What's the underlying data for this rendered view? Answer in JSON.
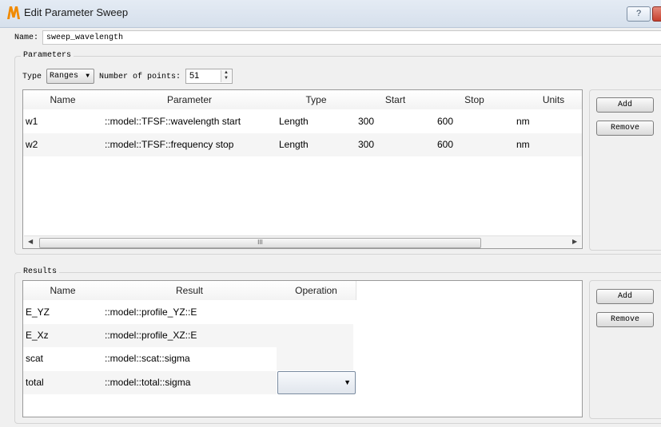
{
  "window": {
    "title": "Edit Parameter Sweep",
    "help_label": "?"
  },
  "name_row": {
    "label": "Name:",
    "value": "sweep_wavelength"
  },
  "parameters": {
    "group_label": "Parameters",
    "type_label": "Type",
    "type_value": "Ranges",
    "points_label": "Number of points:",
    "points_value": "51",
    "columns": [
      "Name",
      "Parameter",
      "Type",
      "Start",
      "Stop",
      "Units"
    ],
    "rows": [
      {
        "name": "w1",
        "parameter": "::model::TFSF::wavelength start",
        "type": "Length",
        "start": "300",
        "stop": "600",
        "units": "nm"
      },
      {
        "name": "w2",
        "parameter": "::model::TFSF::frequency stop",
        "type": "Length",
        "start": "300",
        "stop": "600",
        "units": "nm"
      }
    ],
    "scroll_grip": "III",
    "add_label": "Add",
    "remove_label": "Remove"
  },
  "results": {
    "group_label": "Results",
    "columns": [
      "Name",
      "Result",
      "Operation"
    ],
    "rows": [
      {
        "name": "E_YZ",
        "result": "::model::profile_YZ::E"
      },
      {
        "name": "E_Xz",
        "result": "::model::profile_XZ::E"
      },
      {
        "name": "scat",
        "result": "::model::scat::sigma"
      },
      {
        "name": "total",
        "result": "::model::total::sigma"
      }
    ],
    "add_label": "Add",
    "remove_label": "Remove"
  },
  "colors": {
    "app_icon_orange": "#f08a00",
    "close_red": "#c5402e"
  },
  "icons": [
    "app-logo-icon",
    "help-icon",
    "close-icon",
    "dropdown-arrow-icon",
    "spin-up-icon",
    "spin-down-icon",
    "scroll-left-icon",
    "scroll-right-icon"
  ]
}
